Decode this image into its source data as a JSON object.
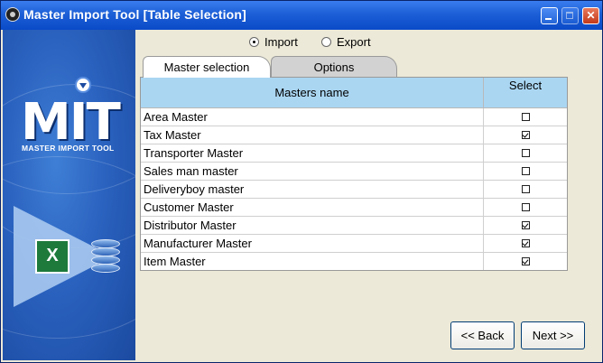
{
  "window": {
    "title": "Master Import Tool [Table Selection]"
  },
  "sidebar": {
    "logo_text": "MIT",
    "logo_caption": "MASTER IMPORT TOOL",
    "excel_glyph": "X",
    "icons": [
      "excel-icon",
      "database-icon"
    ]
  },
  "mode": {
    "import_label": "Import",
    "export_label": "Export",
    "selected": "Import"
  },
  "tabs": [
    {
      "label": "Master selection",
      "active": true
    },
    {
      "label": "Options",
      "active": false
    }
  ],
  "grid": {
    "headers": {
      "name": "Masters name",
      "select": "Select"
    },
    "rows": [
      {
        "name": "Area Master",
        "selected": false
      },
      {
        "name": "Tax Master",
        "selected": true
      },
      {
        "name": "Transporter Master",
        "selected": false
      },
      {
        "name": "Sales man master",
        "selected": false
      },
      {
        "name": "Deliveryboy master",
        "selected": false
      },
      {
        "name": "Customer Master",
        "selected": false
      },
      {
        "name": "Distributor Master",
        "selected": true
      },
      {
        "name": "Manufacturer Master",
        "selected": true
      },
      {
        "name": "Item Master",
        "selected": true
      }
    ]
  },
  "buttons": {
    "back": "<< Back",
    "next": "Next >>"
  },
  "colors": {
    "titlebar": "#1c5fd6",
    "sidebar": "#2a62bf",
    "grid_header": "#aad6f2",
    "window_bg": "#ece9d8"
  }
}
